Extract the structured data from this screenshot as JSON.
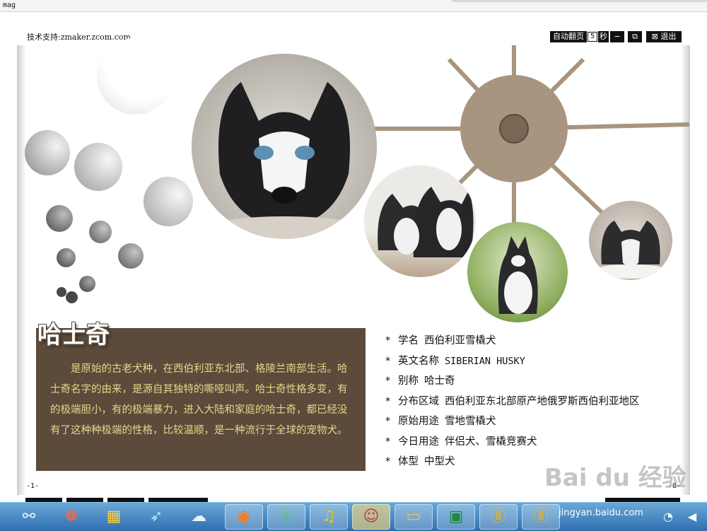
{
  "window": {
    "title": "mag"
  },
  "header": {
    "support": "技术支持:zmaker.zcom.com",
    "autoflip_label": "自动翻页",
    "autoflip_value": "5",
    "autoflip_unit": "秒",
    "exit_label": "退出"
  },
  "page": {
    "title": "哈士奇",
    "description": "是原始的古老犬种，在西伯利亚东北部、格陵兰南部生活。哈士奇名字的由来，是源自其独特的嘶哑叫声。哈士奇性格多变，有的极端胆小，有的极端暴力，进入大陆和家庭的哈士奇，都已经没有了这种种极端的性格，比较温顺，是一种流行于全球的宠物犬。",
    "facts": [
      {
        "label": "学名",
        "value": "西伯利亚雪橇犬"
      },
      {
        "label": "英文名称",
        "value": "SIBERIAN HUSKY"
      },
      {
        "label": "别称",
        "value": "哈士奇"
      },
      {
        "label": "分布区域",
        "value": "西伯利亚东北部原产地俄罗斯西伯利亚地区"
      },
      {
        "label": "原始用途",
        "value": "雪地雪橇犬"
      },
      {
        "label": "今日用途",
        "value": "伴侣犬、雪橇竞赛犬"
      },
      {
        "label": "体型",
        "value": "中型犬"
      }
    ],
    "page_left": "-1-",
    "page_right": "-8-"
  },
  "watermark": {
    "text": "Bai du 经验",
    "sub": "jingyan.baidu.com"
  },
  "colors": {
    "brown_box": "#5c4a3b",
    "desc_text": "#e8d58a",
    "spoke": "#a89580"
  }
}
